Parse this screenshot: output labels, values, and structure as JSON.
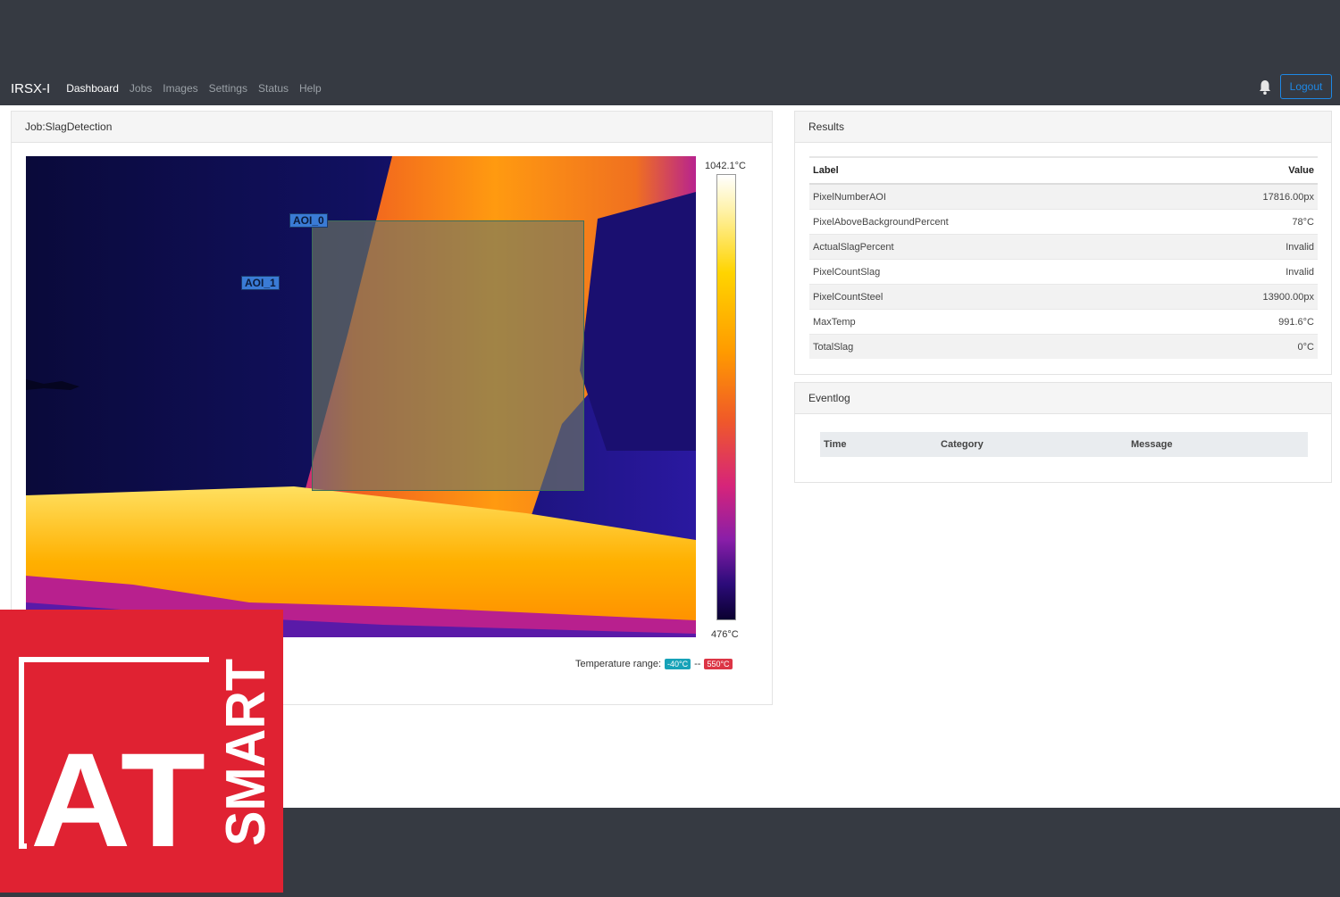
{
  "app": {
    "brand": "IRSX-I"
  },
  "nav": {
    "items": [
      {
        "label": "Dashboard",
        "active": true
      },
      {
        "label": "Jobs"
      },
      {
        "label": "Images"
      },
      {
        "label": "Settings"
      },
      {
        "label": "Status"
      },
      {
        "label": "Help"
      }
    ],
    "logout_label": "Logout",
    "notification_icon": "bell-icon"
  },
  "job": {
    "title": "Job:SlagDetection",
    "aoi_labels": [
      "AOI_0",
      "AOI_1"
    ],
    "scale": {
      "max_label": "1042.1°C",
      "min_label": "476°C"
    },
    "temperature_range": {
      "label": "Temperature range:",
      "low": "-40°C",
      "separator": "--",
      "high": "550°C"
    }
  },
  "results": {
    "title": "Results",
    "headers": {
      "label": "Label",
      "value": "Value"
    },
    "rows": [
      {
        "label": "PixelNumberAOI",
        "value": "17816.00px"
      },
      {
        "label": "PixelAboveBackgroundPercent",
        "value": "78°C"
      },
      {
        "label": "ActualSlagPercent",
        "value": "Invalid"
      },
      {
        "label": "PixelCountSlag",
        "value": "Invalid"
      },
      {
        "label": "PixelCountSteel",
        "value": "13900.00px"
      },
      {
        "label": "MaxTemp",
        "value": "991.6°C"
      },
      {
        "label": "TotalSlag",
        "value": "0°C"
      }
    ]
  },
  "eventlog": {
    "title": "Eventlog",
    "headers": {
      "time": "Time",
      "category": "Category",
      "message": "Message"
    }
  },
  "logo": {
    "text_main": "AT",
    "text_side": "SMART"
  },
  "colors": {
    "navbar": "#363a42",
    "accent": "#1e88e5",
    "logo_red": "#e02232",
    "badge_low": "#17a2b8",
    "badge_high": "#dc3545"
  }
}
